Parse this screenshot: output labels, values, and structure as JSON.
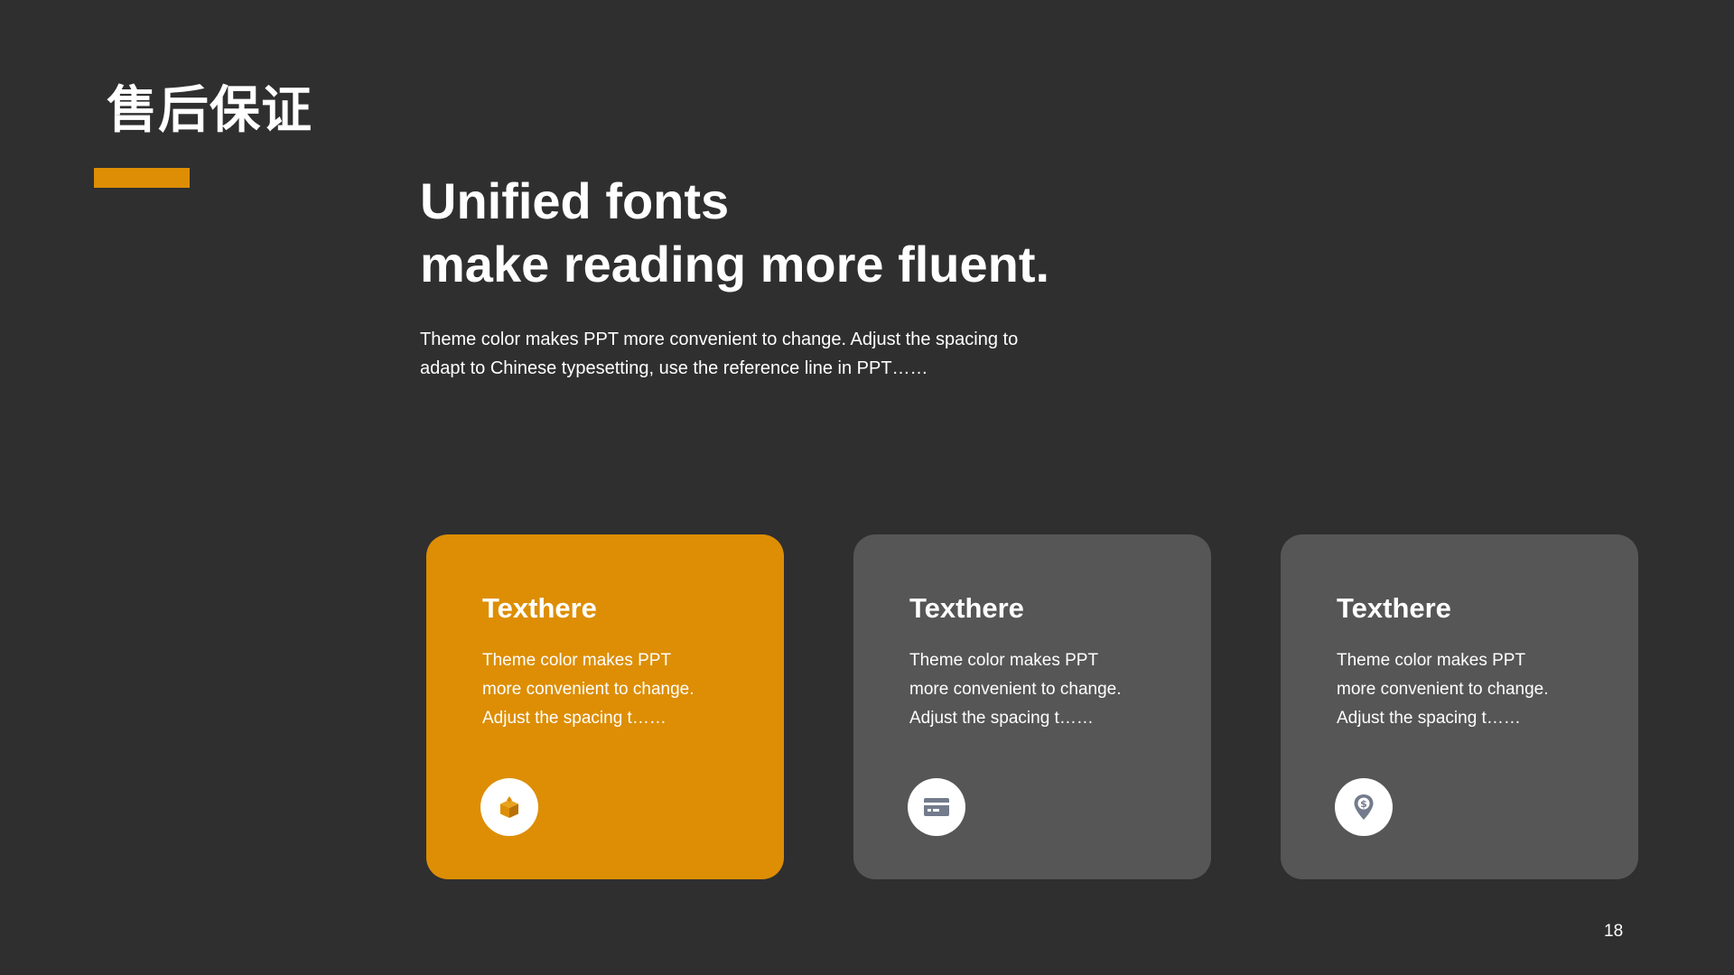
{
  "slide": {
    "title": "售后保证",
    "headline": [
      "Unified fonts",
      "make reading more fluent."
    ],
    "intro": [
      "Theme color makes PPT more convenient  to change. Adjust the spacing to",
      "adapt to Chinese  typesetting, use the reference line in PPT……"
    ],
    "page_number": "18",
    "colors": {
      "background": "#2f2f30",
      "accent": "#dd8e04",
      "card": "#565656",
      "text": "#ffffff"
    }
  },
  "cards": [
    {
      "title": "Texthere",
      "text": [
        "Theme color makes PPT",
        "more convenient  to change.",
        "Adjust the spacing t……"
      ],
      "icon": "box-icon",
      "highlighted": true
    },
    {
      "title": "Texthere",
      "text": [
        "Theme color makes PPT",
        "more convenient  to change.",
        "Adjust the spacing t……"
      ],
      "icon": "credit-card-icon",
      "highlighted": false
    },
    {
      "title": "Texthere",
      "text": [
        "Theme color makes PPT",
        "more convenient  to change.",
        "Adjust the spacing t……"
      ],
      "icon": "location-dollar-icon",
      "highlighted": false
    }
  ]
}
